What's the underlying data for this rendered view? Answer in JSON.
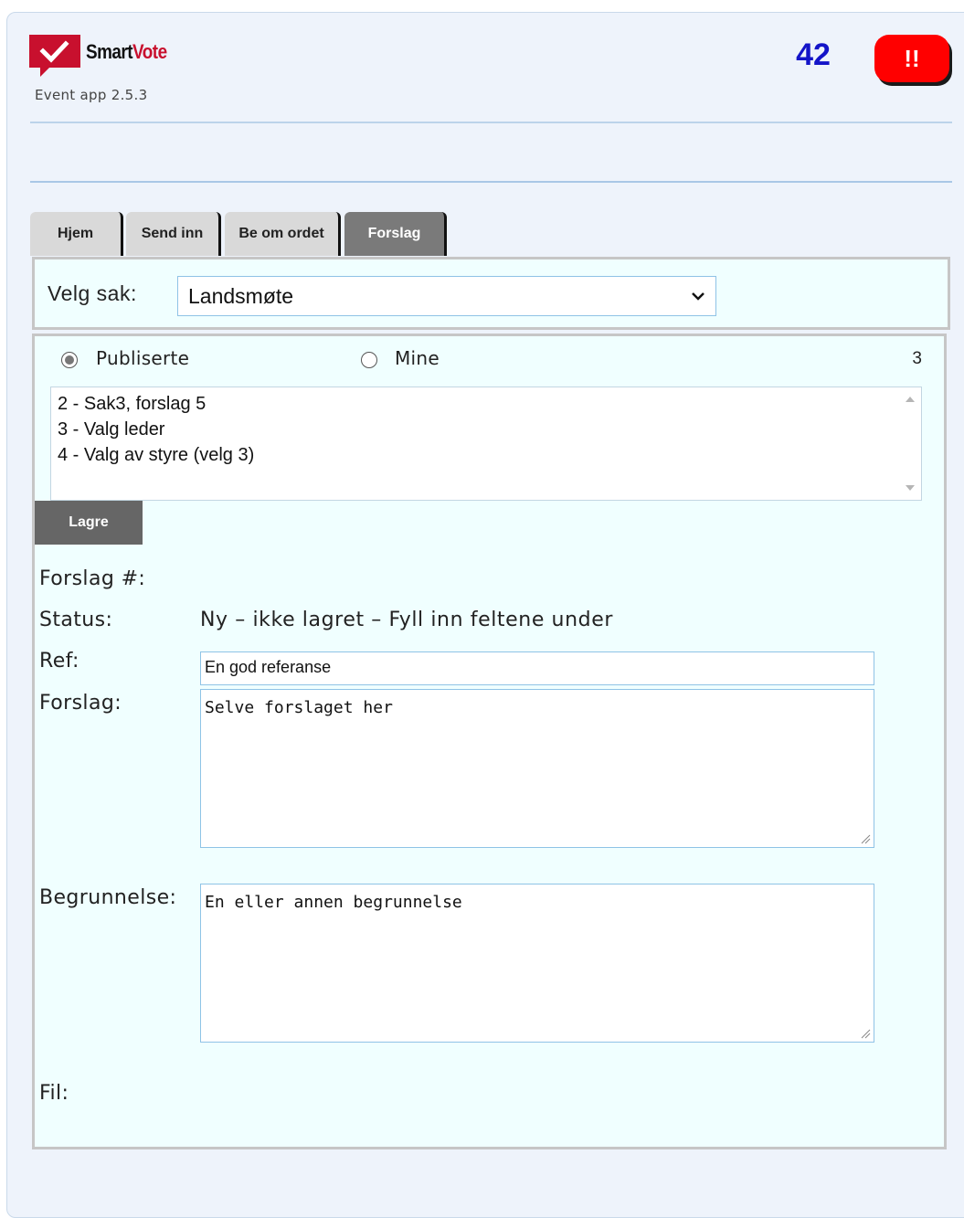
{
  "header": {
    "brand_smart": "Smart",
    "brand_vote": "Vote",
    "version": "Event app 2.5.3",
    "counter": "42",
    "alert_label": "!!"
  },
  "tabs": [
    {
      "label": "Hjem",
      "active": false
    },
    {
      "label": "Send inn",
      "active": false
    },
    {
      "label": "Be om ordet",
      "active": false
    },
    {
      "label": "Forslag",
      "active": true
    }
  ],
  "case_select": {
    "label": "Velg sak:",
    "selected": "Landsmøte"
  },
  "filter": {
    "published_label": "Publiserte",
    "mine_label": "Mine",
    "selected": "Publiserte",
    "count": "3"
  },
  "proposals_list": [
    "2 - Sak3, forslag 5",
    "3 - Valg leder",
    "4 - Valg av styre (velg 3)"
  ],
  "save_label": "Lagre",
  "form": {
    "number_label": "Forslag #:",
    "status_label": "Status:",
    "status_value": "Ny – ikke lagret – Fyll inn feltene under",
    "ref_label": "Ref:",
    "ref_value": "En god referanse",
    "proposal_label": "Forslag:",
    "proposal_value": "Selve forslaget her",
    "reason_label": "Begrunnelse:",
    "reason_value": "En eller annen begrunnelse",
    "file_label": "Fil:"
  },
  "colors": {
    "brand_red": "#c8102e",
    "counter_blue": "#1414c8",
    "alert_red": "#ff0000",
    "panel_bg": "#f0ffff",
    "active_tab": "#7a7a7a"
  }
}
